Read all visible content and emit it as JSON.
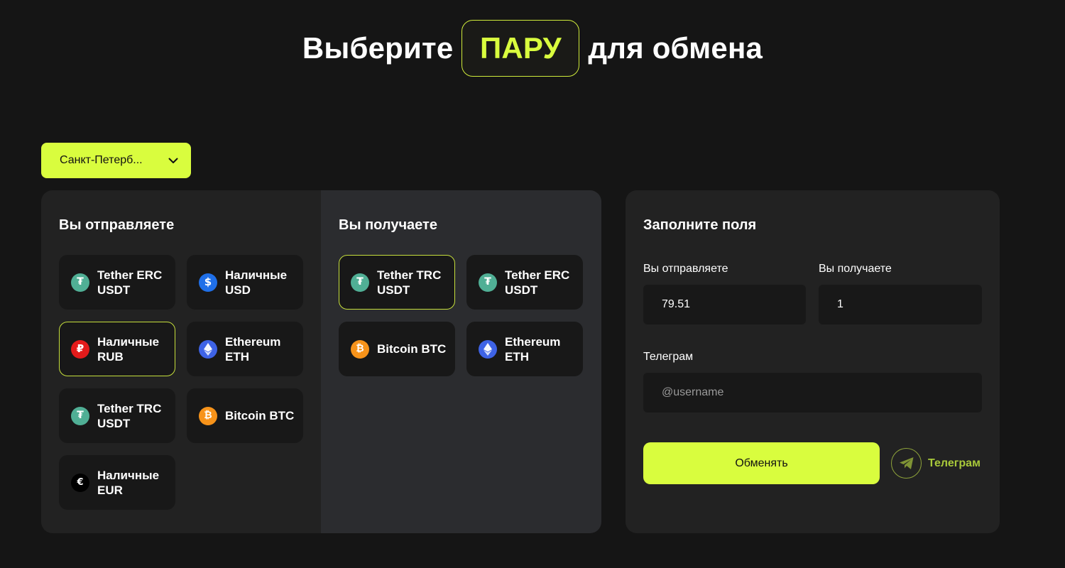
{
  "heading": {
    "before": "Выберите",
    "highlight": "ПАРУ",
    "after": "для обмена"
  },
  "city_select": {
    "value": "Санкт-Петерб...",
    "icon": "chevron-down-icon"
  },
  "send": {
    "title": "Вы отправляете",
    "items": [
      {
        "line1": "Tether ERC",
        "line2": "USDT",
        "icon": "tether-icon",
        "active": false
      },
      {
        "line1": "Наличные",
        "line2": "USD",
        "icon": "dollar-icon",
        "active": false
      },
      {
        "line1": "Наличные",
        "line2": "RUB",
        "icon": "ruble-icon",
        "active": true
      },
      {
        "line1": "Ethereum",
        "line2": "ETH",
        "icon": "ethereum-icon",
        "active": false
      },
      {
        "line1": "Tether TRC",
        "line2": "USDT",
        "icon": "tether-icon",
        "active": false
      },
      {
        "line1": "Bitcoin BTC",
        "line2": "",
        "icon": "bitcoin-icon",
        "active": false
      },
      {
        "line1": "Наличные",
        "line2": "EUR",
        "icon": "euro-icon",
        "active": false
      }
    ]
  },
  "receive": {
    "title": "Вы получаете",
    "items": [
      {
        "line1": "Tether TRC",
        "line2": "USDT",
        "icon": "tether-icon",
        "active": true
      },
      {
        "line1": "Tether ERC",
        "line2": "USDT",
        "icon": "tether-icon",
        "active": false
      },
      {
        "line1": "Bitcoin BTC",
        "line2": "",
        "icon": "bitcoin-icon",
        "active": false
      },
      {
        "line1": "Ethereum",
        "line2": "ETH",
        "icon": "ethereum-icon",
        "active": false
      }
    ]
  },
  "form": {
    "title": "Заполните поля",
    "send_label": "Вы отправляете",
    "send_value": "79.51",
    "receive_label": "Вы получаете",
    "receive_value": "1",
    "telegram_label": "Телеграм",
    "telegram_placeholder": "@username",
    "submit_label": "Обменять",
    "telegram_link_label": "Телеграм"
  },
  "colors": {
    "accent": "#d9fd3e",
    "background": "#151515",
    "panel": "#222222",
    "panel_alt": "#2b2c2f",
    "tile": "#181818"
  }
}
